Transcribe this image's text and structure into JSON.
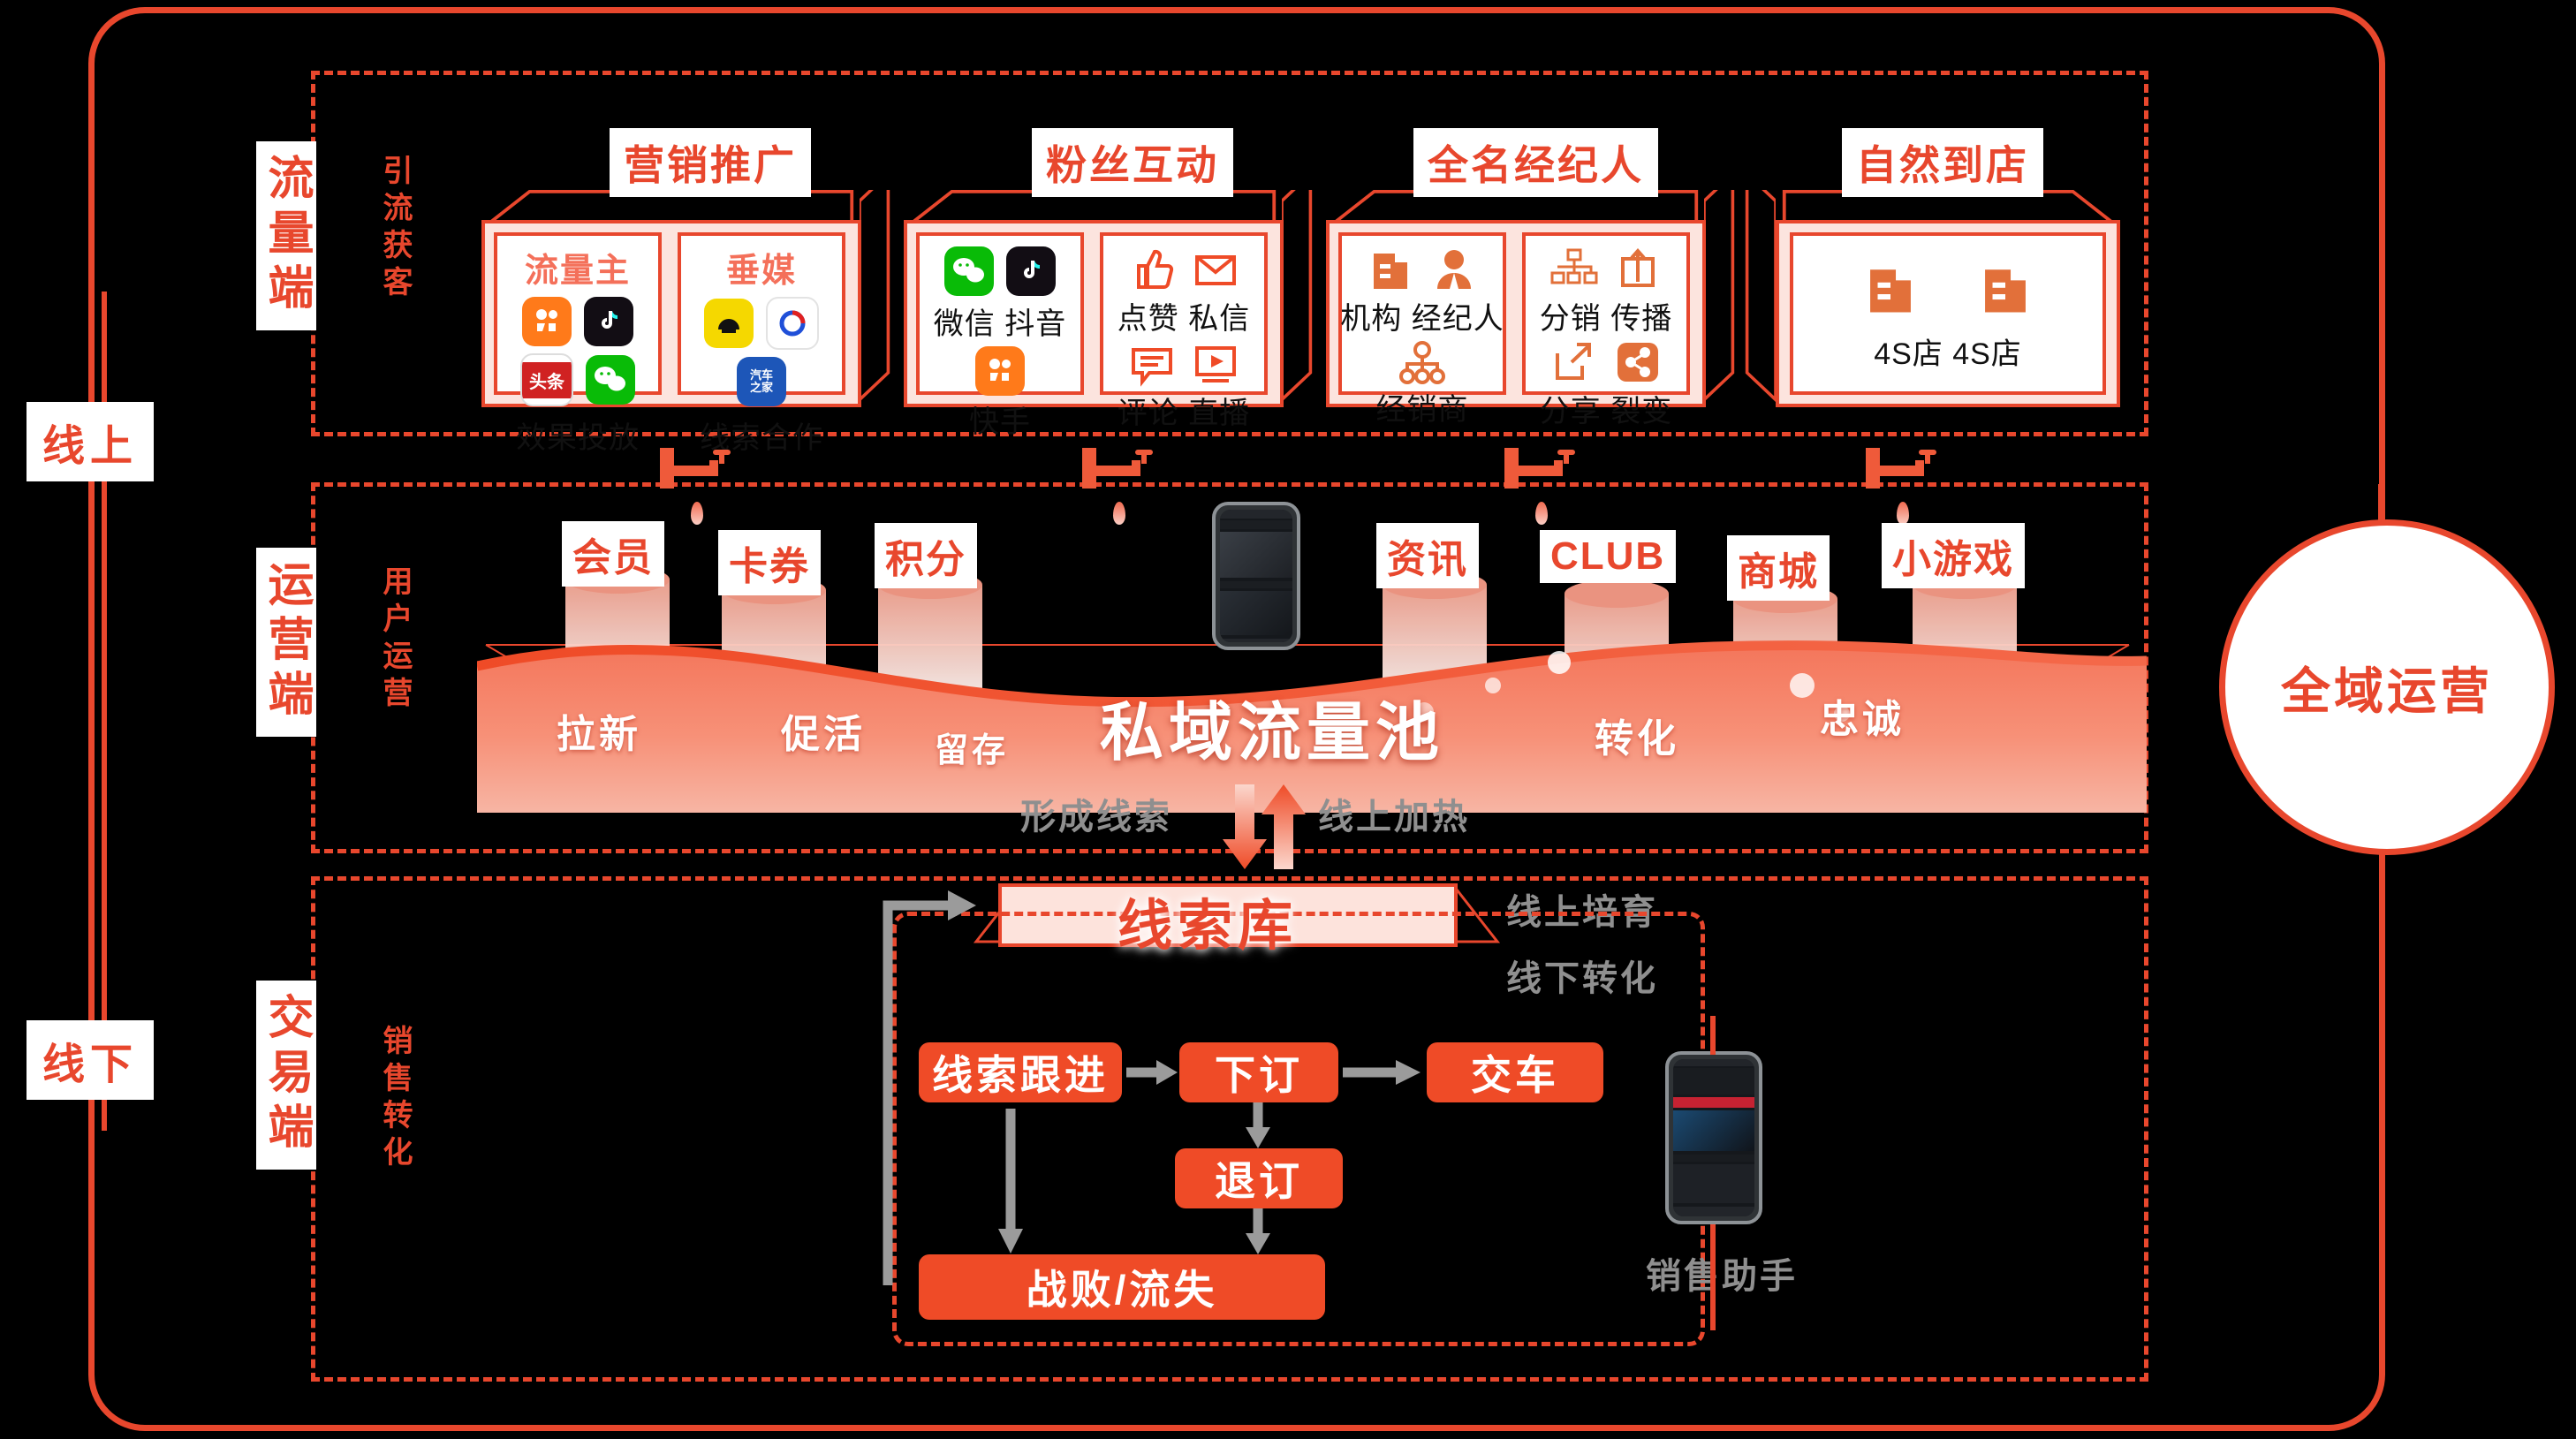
{
  "frame": {
    "online_label": "线上",
    "offline_label": "线下"
  },
  "sections": [
    {
      "id": "traffic",
      "stage": "流量端",
      "sub": "引流获客"
    },
    {
      "id": "ops",
      "stage": "运营端",
      "sub": "用户运营"
    },
    {
      "id": "deal",
      "stage": "交易端",
      "sub": "销售转化"
    }
  ],
  "traffic_cubes": [
    {
      "title": "营销推广",
      "panels": [
        {
          "heading": "流量主",
          "apps": [
            "kuaishou-icon",
            "douyin-icon",
            "toutiao-icon",
            "wechat-icon"
          ],
          "app_labels": [
            "快手",
            "抖音",
            "头条",
            "微信"
          ],
          "caption": "效果投放"
        },
        {
          "heading": "垂媒",
          "apps": [
            "dongchedi-icon",
            "yiche-icon",
            "autohome-icon"
          ],
          "app_labels": [
            "懂车帝",
            "易车",
            "汽车之家"
          ],
          "caption": "线索合作"
        }
      ]
    },
    {
      "title": "粉丝互动",
      "panels": [
        {
          "heading": "",
          "apps": [
            "wechat-icon",
            "douyin-icon",
            "kuaishou-icon"
          ],
          "app_labels": [
            "微信",
            "抖音",
            "快手"
          ],
          "captions": [
            "微信 抖音",
            "快手"
          ]
        },
        {
          "heading": "",
          "apps": [
            "thumbup-icon",
            "envelope-icon",
            "comment-icon",
            "play-icon"
          ],
          "captions": [
            "点赞 私信",
            "评论 直播"
          ]
        }
      ]
    },
    {
      "title": "全名经纪人",
      "panels": [
        {
          "heading": "",
          "apps": [
            "building-icon",
            "person-tie-icon",
            "org-chart-icon"
          ],
          "captions": [
            "机构  经纪人",
            "经销商"
          ]
        },
        {
          "heading": "",
          "apps": [
            "distribution-icon",
            "upload-box-icon",
            "external-link-icon",
            "share-icon"
          ],
          "captions": [
            "分销 传播",
            "分享 裂变"
          ]
        }
      ]
    },
    {
      "title": "自然到店",
      "panels": [
        {
          "heading": "",
          "apps": [
            "building-icon",
            "building-icon"
          ],
          "captions": [
            "4S店    4S店"
          ]
        }
      ]
    }
  ],
  "ops": {
    "pillars": [
      "会员",
      "卡券",
      "积分",
      "资讯",
      "CLUB",
      "商城",
      "小游戏"
    ],
    "pool_title": "私域流量池",
    "pool_stages": [
      "拉新",
      "促活",
      "留存",
      "转化",
      "忠诚"
    ]
  },
  "mid_arrows": {
    "down_label": "形成线索",
    "up_label": "线上加热"
  },
  "deal": {
    "lead_pool": "线索库",
    "right_notes": [
      "线上培育",
      "线下转化"
    ],
    "flow": [
      "线索跟进",
      "下订",
      "交车",
      "退订",
      "战败/流失"
    ],
    "phone_caption": "销售助手"
  },
  "right_circle": {
    "label": "全域运营"
  },
  "colors": {
    "accent": "#e8472d",
    "flow_box": "#ef4b27",
    "panel_bg": "#fce4de",
    "grey": "#9b9b9b"
  }
}
